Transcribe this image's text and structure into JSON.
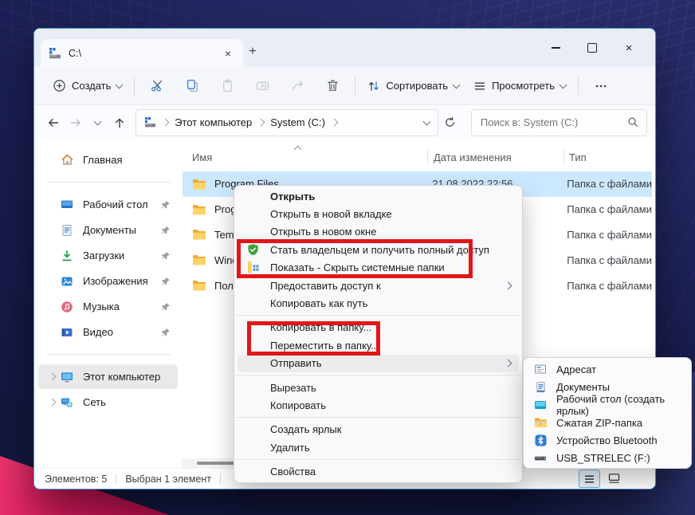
{
  "titlebar": {
    "tab_title": "C:\\",
    "new_tab_glyph": "+",
    "close_glyph": "×"
  },
  "toolbar": {
    "create": "Создать",
    "sort": "Сортировать",
    "view": "Просмотреть"
  },
  "addressbar": {
    "crumb1": "Этот компьютер",
    "crumb2": "System (C:)",
    "search_placeholder": "Поиск в: System (C:)"
  },
  "sidebar": {
    "items": [
      {
        "label": "Главная"
      },
      {
        "label": "Рабочий стол",
        "pinned": true
      },
      {
        "label": "Документы",
        "pinned": true
      },
      {
        "label": "Загрузки",
        "pinned": true
      },
      {
        "label": "Изображения",
        "pinned": true
      },
      {
        "label": "Музыка",
        "pinned": true
      },
      {
        "label": "Видео",
        "pinned": true
      },
      {
        "label": "Этот компьютер",
        "expandable": true,
        "selected": true
      },
      {
        "label": "Сеть",
        "expandable": true
      }
    ]
  },
  "filelist": {
    "headers": [
      "Имя",
      "Дата изменения",
      "Тип"
    ],
    "rows": [
      {
        "name": "Program Files",
        "date": "21.08.2022 22:56",
        "type": "Папка с файлами",
        "selected": true
      },
      {
        "name": "Progra",
        "date": "",
        "type": "Папка с файлами"
      },
      {
        "name": "Temp",
        "date": "",
        "type": "Папка с файлами"
      },
      {
        "name": "Windo",
        "date": "",
        "type": "Папка с файлами"
      },
      {
        "name": "Польз",
        "date": "",
        "type": "Папка с файлами"
      }
    ]
  },
  "context_menu": {
    "items": [
      {
        "label": "Открыть"
      },
      {
        "label": "Открыть в новой вкладке"
      },
      {
        "label": "Открыть в новом окне"
      },
      {
        "label": "Стать владельцем и получить полный доступ"
      },
      {
        "label": "Показать - Скрыть системные папки"
      },
      {
        "label": "Предоставить доступ к"
      },
      {
        "label": "Копировать как путь"
      },
      {
        "label": "Копировать в папку..."
      },
      {
        "label": "Переместить в папку..."
      },
      {
        "label": "Отправить"
      },
      {
        "label": "Вырезать"
      },
      {
        "label": "Копировать"
      },
      {
        "label": "Создать ярлык"
      },
      {
        "label": "Удалить"
      },
      {
        "label": "Свойства"
      }
    ]
  },
  "send_to_menu": {
    "items": [
      {
        "label": "Адресат"
      },
      {
        "label": "Документы"
      },
      {
        "label": "Рабочий стол (создать ярлык)"
      },
      {
        "label": "Сжатая ZIP-папка"
      },
      {
        "label": "Устройство Bluetooth"
      },
      {
        "label": "USB_STRELEC (F:)"
      }
    ]
  },
  "statusbar": {
    "count": "Элементов: 5",
    "selection": "Выбран 1 элемент"
  },
  "colors": {
    "annotation_red": "#e21717",
    "selection_blue": "#cce8ff",
    "window_border": "#4792da"
  }
}
